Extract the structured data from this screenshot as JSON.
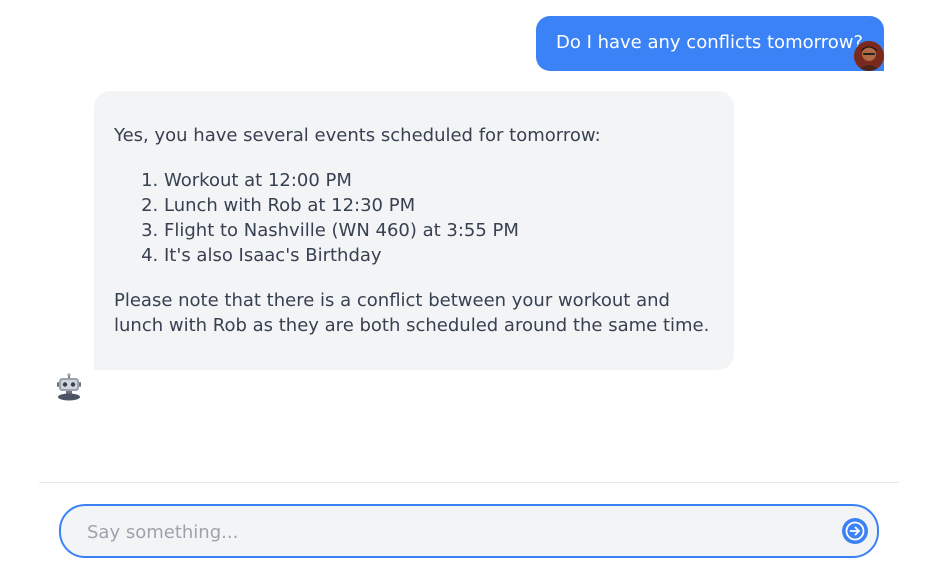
{
  "messages": {
    "user": {
      "text": "Do I have any conflicts tomorrow?"
    },
    "bot": {
      "intro": "Yes, you have several events scheduled for tomorrow:",
      "items": [
        "Workout at 12:00 PM",
        "Lunch with Rob at 12:30 PM",
        "Flight to Nashville (WN 460) at 3:55 PM",
        "It's also Isaac's Birthday"
      ],
      "note": "Please note that there is a conflict between your workout and lunch with Rob as they are both scheduled around the same time."
    }
  },
  "composer": {
    "placeholder": "Say something...",
    "value": ""
  },
  "icons": {
    "send": "arrow-circle-right-icon",
    "user_avatar": "user-avatar",
    "bot_avatar": "robot-icon"
  },
  "colors": {
    "accent": "#3b82f6",
    "bot_bubble": "#f3f4f6",
    "text": "#374151",
    "placeholder": "#9ca3af"
  }
}
